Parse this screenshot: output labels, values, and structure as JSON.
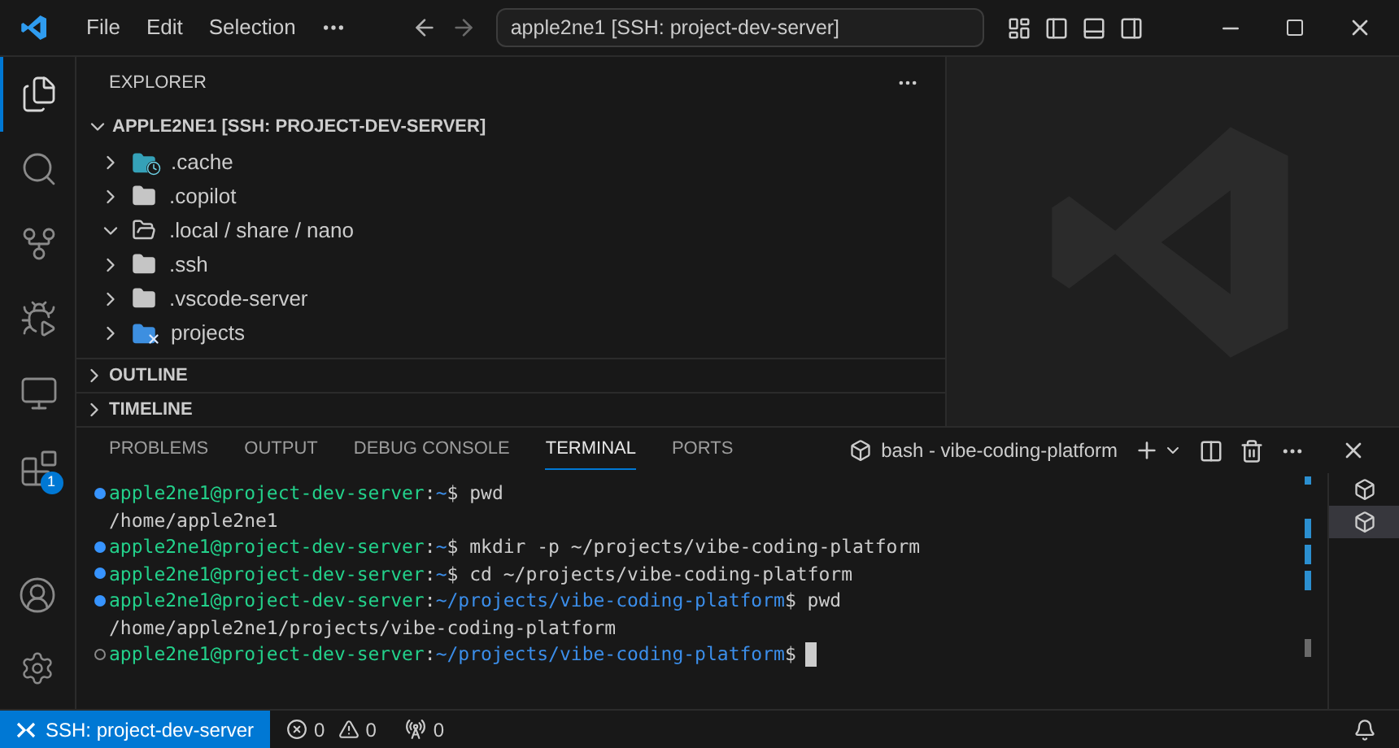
{
  "title_bar": {
    "menu": [
      "File",
      "Edit",
      "Selection"
    ],
    "command_center": "apple2ne1 [SSH: project-dev-server]"
  },
  "activity_bar": [
    {
      "kind": "explorer",
      "selected": true
    },
    {
      "kind": "search",
      "selected": false
    },
    {
      "kind": "source-control",
      "selected": false
    },
    {
      "kind": "run-debug",
      "selected": false
    },
    {
      "kind": "remote",
      "selected": false
    },
    {
      "kind": "extensions",
      "selected": false,
      "badge": "1"
    }
  ],
  "explorer": {
    "title": "EXPLORER",
    "root": {
      "label": "APPLE2NE1 [SSH: PROJECT-DEV-SERVER]",
      "expanded": true
    },
    "items": [
      {
        "kind": "cache",
        "label": ".cache",
        "expanded": false
      },
      {
        "kind": "folder",
        "label": ".copilot",
        "expanded": false
      },
      {
        "kind": "folder",
        "label": ".local / share / nano",
        "expanded": true
      },
      {
        "kind": "folder",
        "label": ".ssh",
        "expanded": false
      },
      {
        "kind": "folder",
        "label": ".vscode-server",
        "expanded": false
      },
      {
        "kind": "remote",
        "label": "projects",
        "expanded": false
      }
    ],
    "sections": [
      {
        "label": "OUTLINE",
        "expanded": false
      },
      {
        "label": "TIMELINE",
        "expanded": false
      }
    ]
  },
  "panel": {
    "tabs": [
      {
        "label": "PROBLEMS",
        "selected": false
      },
      {
        "label": "OUTPUT",
        "selected": false
      },
      {
        "label": "DEBUG CONSOLE",
        "selected": false
      },
      {
        "label": "TERMINAL",
        "selected": true
      },
      {
        "label": "PORTS",
        "selected": false
      }
    ],
    "terminal_name": "bash - vibe-coding-platform",
    "lines": [
      {
        "kind": "success",
        "segments": [
          {
            "color": "#23d18b",
            "text": "apple2ne1@project-dev-server"
          },
          {
            "color": "#cccccc",
            "text": ":"
          },
          {
            "color": "#3b8eea",
            "text": "~"
          },
          {
            "color": "#cccccc",
            "text": "$ pwd"
          }
        ]
      },
      {
        "kind": "output",
        "segments": [
          {
            "color": "#cccccc",
            "text": "/home/apple2ne1"
          }
        ]
      },
      {
        "kind": "success",
        "segments": [
          {
            "color": "#23d18b",
            "text": "apple2ne1@project-dev-server"
          },
          {
            "color": "#cccccc",
            "text": ":"
          },
          {
            "color": "#3b8eea",
            "text": "~"
          },
          {
            "color": "#cccccc",
            "text": "$ mkdir -p ~/projects/vibe-coding-platform"
          }
        ]
      },
      {
        "kind": "success",
        "segments": [
          {
            "color": "#23d18b",
            "text": "apple2ne1@project-dev-server"
          },
          {
            "color": "#cccccc",
            "text": ":"
          },
          {
            "color": "#3b8eea",
            "text": "~"
          },
          {
            "color": "#cccccc",
            "text": "$ cd ~/projects/vibe-coding-platform"
          }
        ]
      },
      {
        "kind": "success",
        "segments": [
          {
            "color": "#23d18b",
            "text": "apple2ne1@project-dev-server"
          },
          {
            "color": "#cccccc",
            "text": ":"
          },
          {
            "color": "#3b8eea",
            "text": "~/projects/vibe-coding-platform"
          },
          {
            "color": "#cccccc",
            "text": "$ pwd"
          }
        ]
      },
      {
        "kind": "output",
        "segments": [
          {
            "color": "#cccccc",
            "text": "/home/apple2ne1/projects/vibe-coding-platform"
          }
        ]
      },
      {
        "kind": "pending",
        "cursor": true,
        "segments": [
          {
            "color": "#23d18b",
            "text": "apple2ne1@project-dev-server"
          },
          {
            "color": "#cccccc",
            "text": ":"
          },
          {
            "color": "#3b8eea",
            "text": "~/projects/vibe-coding-platform"
          },
          {
            "color": "#cccccc",
            "text": "$"
          }
        ]
      }
    ],
    "terminals": [
      {
        "selected": false
      },
      {
        "selected": true
      }
    ]
  },
  "status_bar": {
    "remote": "SSH: project-dev-server",
    "errors": "0",
    "warnings": "0",
    "ports": "0"
  }
}
